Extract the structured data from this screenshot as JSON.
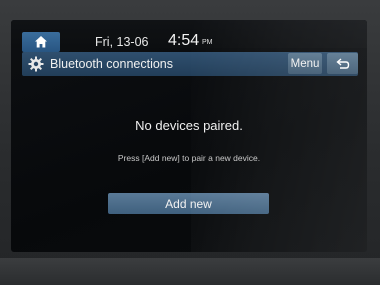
{
  "status_bar": {
    "home_icon": "home-icon",
    "date": "Fri, 13-06",
    "time": "4:54",
    "ampm": "PM"
  },
  "title_bar": {
    "icon": "gear-icon",
    "title": "Bluetooth connections",
    "menu_label": "Menu",
    "back_icon": "back-icon"
  },
  "main": {
    "message": "No devices paired.",
    "hint": "Press [Add new] to pair a new device.",
    "add_new_label": "Add new"
  },
  "colors": {
    "accent": "#2f5f8f",
    "button": "#4d6b86",
    "screen_bg": "#0a0c0e"
  }
}
